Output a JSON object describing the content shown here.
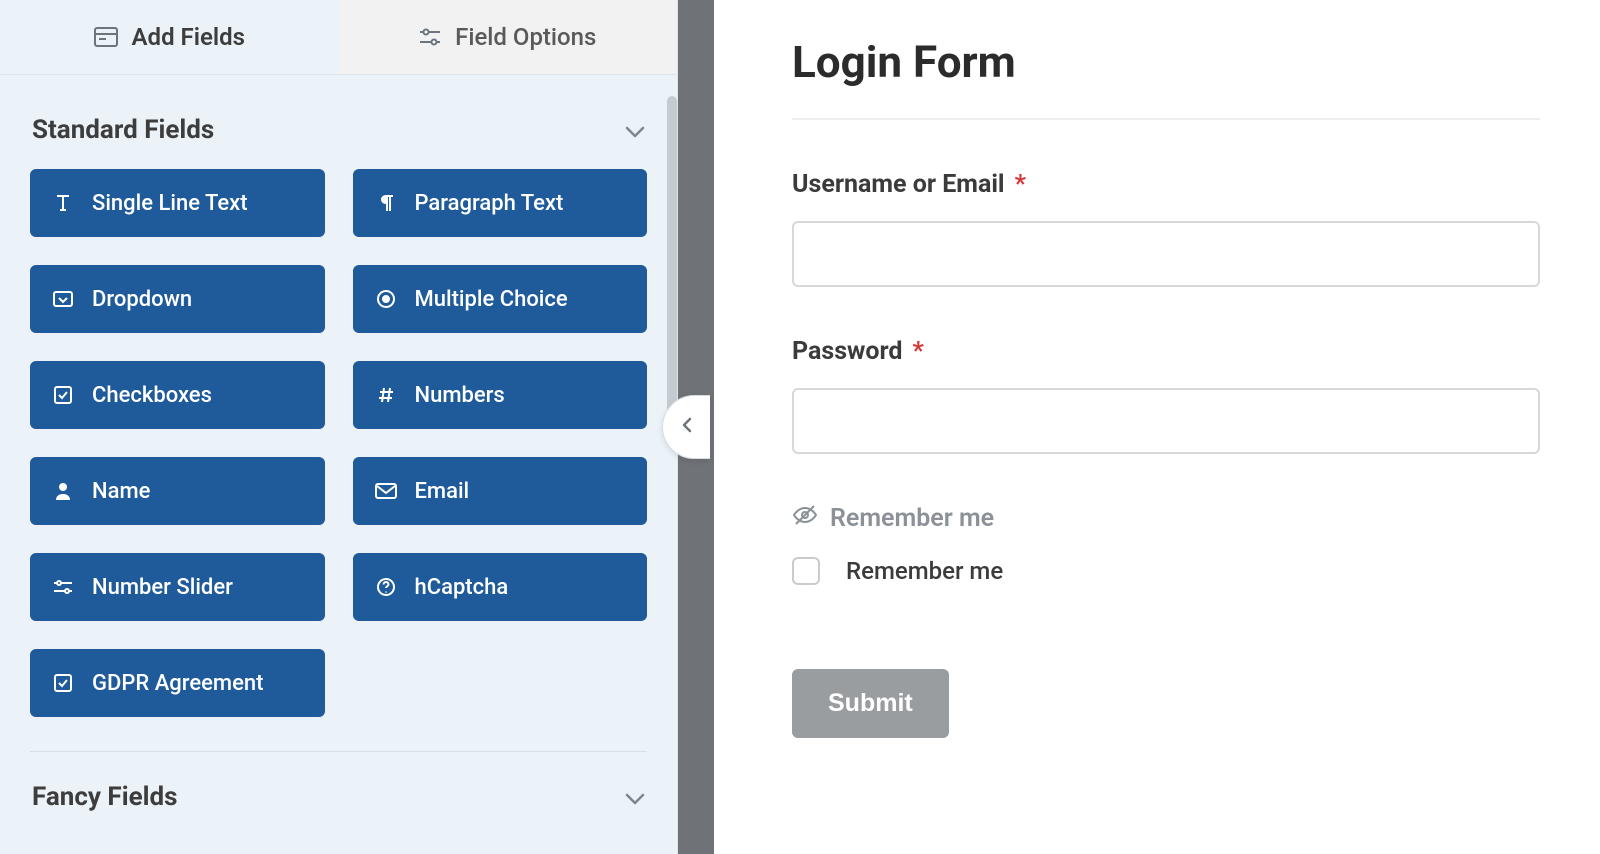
{
  "tabs": {
    "add_fields": "Add Fields",
    "field_options": "Field Options"
  },
  "sections": {
    "standard": "Standard Fields",
    "fancy": "Fancy Fields"
  },
  "fields": {
    "single_line_text": "Single Line Text",
    "paragraph_text": "Paragraph Text",
    "dropdown": "Dropdown",
    "multiple_choice": "Multiple Choice",
    "checkboxes": "Checkboxes",
    "numbers": "Numbers",
    "name": "Name",
    "email": "Email",
    "number_slider": "Number Slider",
    "hcaptcha": "hCaptcha",
    "gdpr": "GDPR Agreement"
  },
  "form": {
    "title": "Login Form",
    "username_label": "Username or Email",
    "password_label": "Password",
    "required_mark": "*",
    "remember_title": "Remember me",
    "remember_option": "Remember me",
    "submit": "Submit"
  }
}
